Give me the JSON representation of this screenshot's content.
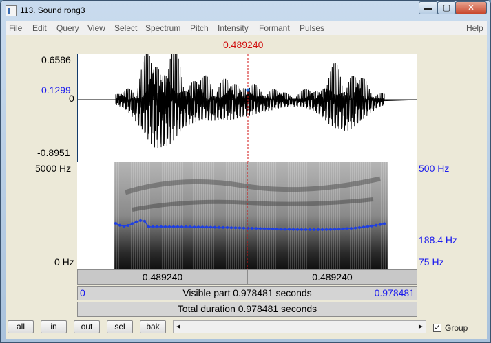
{
  "window": {
    "title": "113. Sound rong3",
    "minimize": "▬",
    "maximize": "▢",
    "close": "✕"
  },
  "menu": [
    "File",
    "Edit",
    "Query",
    "View",
    "Select",
    "Spectrum",
    "Pitch",
    "Intensity",
    "Formant",
    "Pulses"
  ],
  "menu_help": "Help",
  "cursor_time": "0.489240",
  "cursor_fraction": 0.5,
  "waveform": {
    "y_max": "0.6586",
    "y_cursor": "0.1299",
    "y_zero": "0",
    "y_min": "-0.8951"
  },
  "spectrogram": {
    "freq_top": "5000 Hz",
    "freq_bottom": "0 Hz",
    "pitch_top": "500 Hz",
    "pitch_cursor": "188.4 Hz",
    "pitch_bottom": "75 Hz"
  },
  "bars": {
    "left_time": "0.489240",
    "right_time": "0.489240",
    "visible_start": "0",
    "visible_label": "Visible part 0.978481 seconds",
    "visible_end": "0.978481",
    "total_label": "Total duration 0.978481 seconds"
  },
  "toolbar": {
    "all": "all",
    "in": "in",
    "out": "out",
    "sel": "sel",
    "bak": "bak",
    "scroll_left": "◄",
    "scroll_right": "►",
    "group_check": "✓",
    "group_label": "Group"
  },
  "colors": {
    "cursor": "#d01010",
    "axis_blue": "#1a1aee",
    "pitch": "#1f3fe0"
  }
}
